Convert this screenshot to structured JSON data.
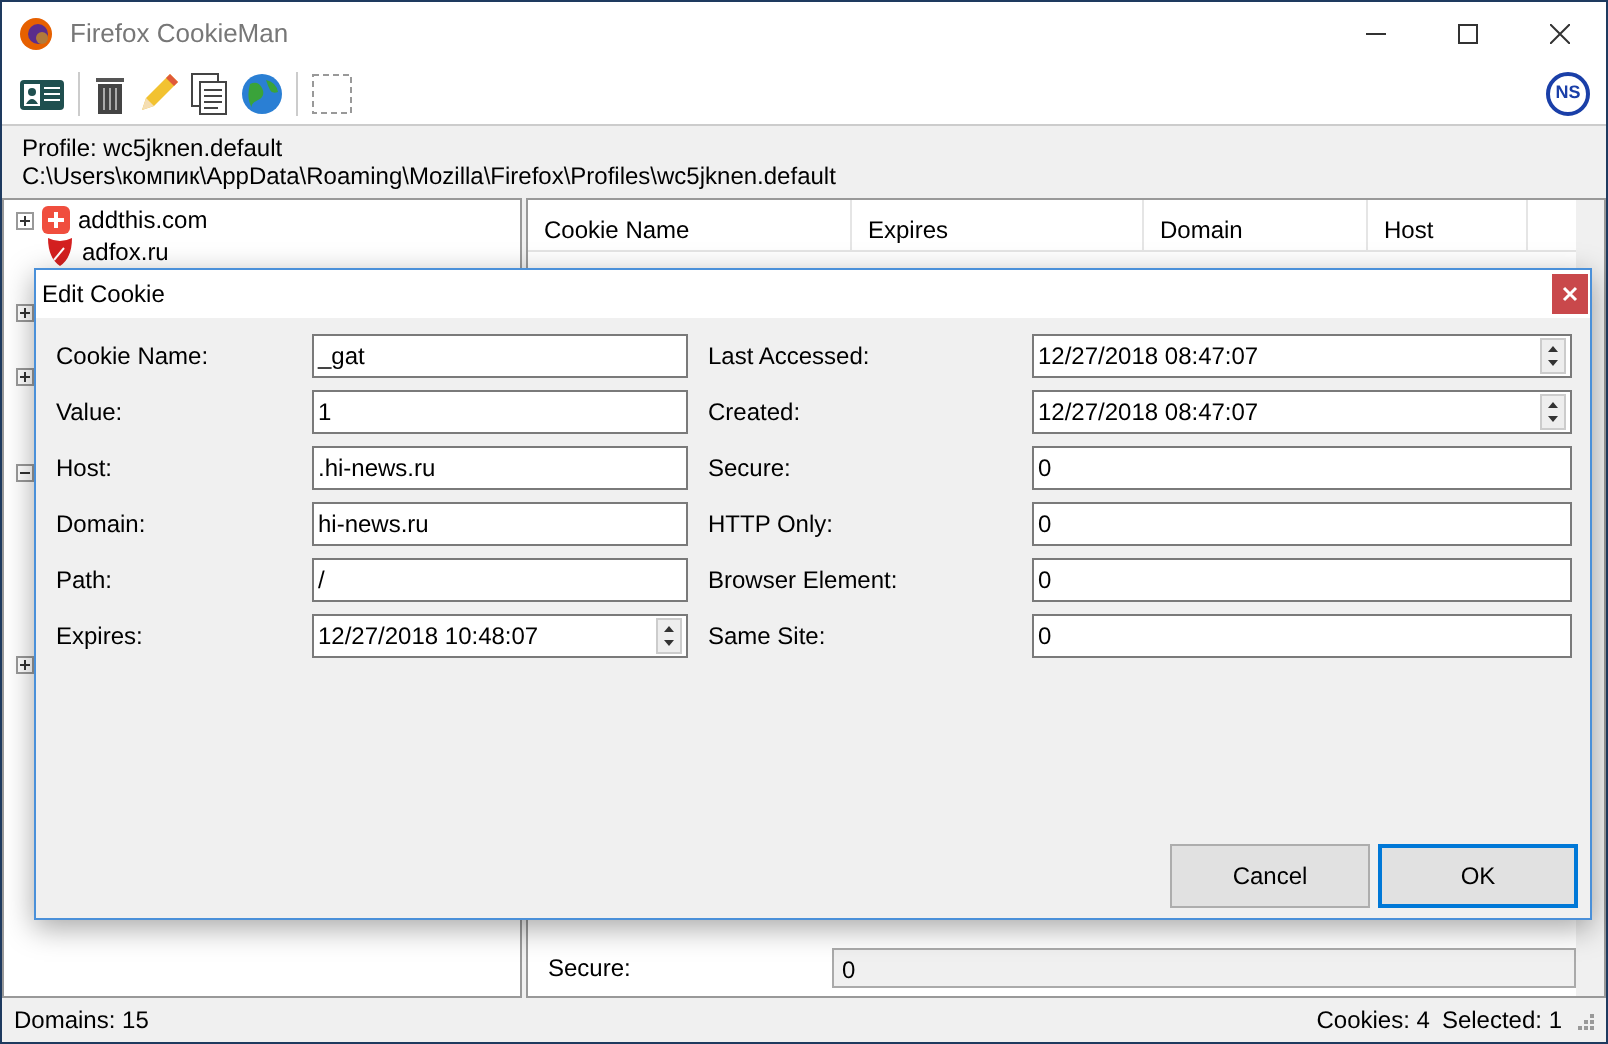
{
  "window": {
    "title": "Firefox CookieMan",
    "logo": "NS"
  },
  "profile": {
    "name": "Profile: wc5jknen.default",
    "path": "C:\\Users\\компик\\AppData\\Roaming\\Mozilla\\Firefox\\Profiles\\wc5jknen.default"
  },
  "tree": {
    "items": [
      {
        "label": "addthis.com",
        "expanded": false,
        "kind": "addthis"
      },
      {
        "label": "adfox.ru",
        "kind": "adfox"
      },
      {
        "expanded": false
      },
      {
        "expanded": false
      },
      {
        "expanded": true
      },
      {
        "expanded": false
      }
    ]
  },
  "table": {
    "columns": [
      "Cookie Name",
      "Expires",
      "Domain",
      "Host"
    ]
  },
  "details": [
    {
      "label": "Secure:",
      "value": "0"
    }
  ],
  "dialog": {
    "title": "Edit Cookie",
    "left_fields": [
      {
        "label": "Cookie Name:",
        "value": "_gat",
        "kind": "text"
      },
      {
        "label": "Value:",
        "value": "1",
        "kind": "text"
      },
      {
        "label": "Host:",
        "value": ".hi-news.ru",
        "kind": "text"
      },
      {
        "label": "Domain:",
        "value": "hi-news.ru",
        "kind": "text"
      },
      {
        "label": "Path:",
        "value": "/",
        "kind": "text"
      },
      {
        "label": "Expires:",
        "value": "12/27/2018 10:48:07",
        "kind": "datetime"
      }
    ],
    "right_fields": [
      {
        "label": "Last Accessed:",
        "value": "12/27/2018 08:47:07",
        "kind": "datetime"
      },
      {
        "label": "Created:",
        "value": "12/27/2018 08:47:07",
        "kind": "datetime"
      },
      {
        "label": "Secure:",
        "value": "0",
        "kind": "text"
      },
      {
        "label": "HTTP Only:",
        "value": "0",
        "kind": "text"
      },
      {
        "label": "Browser Element:",
        "value": "0",
        "kind": "text"
      },
      {
        "label": "Same Site:",
        "value": "0",
        "kind": "text"
      }
    ],
    "buttons": [
      {
        "label": "Cancel",
        "default": false
      },
      {
        "label": "OK",
        "default": true
      }
    ]
  },
  "status_bar": {
    "domains": "Domains: 15",
    "cookies": "Cookies: 4",
    "selected": "Selected: 1"
  }
}
